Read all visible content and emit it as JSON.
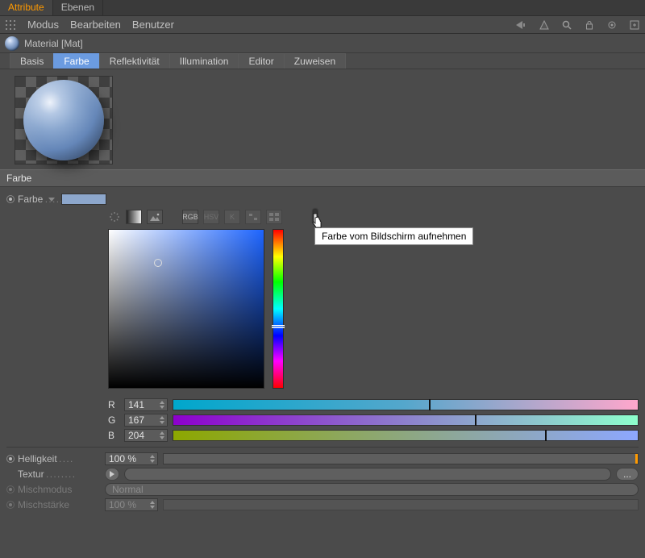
{
  "top_tabs": {
    "attribute": "Attribute",
    "ebenen": "Ebenen"
  },
  "menubar": {
    "modus": "Modus",
    "bearbeiten": "Bearbeiten",
    "benutzer": "Benutzer"
  },
  "material_label": "Material [Mat]",
  "chan": {
    "basis": "Basis",
    "farbe": "Farbe",
    "reflek": "Reflektivität",
    "illum": "Illumination",
    "editor": "Editor",
    "zuweisen": "Zuweisen"
  },
  "section_title": "Farbe",
  "params": {
    "farbe_label": "Farbe",
    "helligkeit_label": "Helligkeit",
    "helligkeit_value": "100 %",
    "textur_label": "Textur",
    "mischmodus_label": "Mischmodus",
    "mischmodus_value": "Normal",
    "mischstaerke_label": "Mischstärke",
    "mischstaerke_value": "100 %"
  },
  "color": {
    "swatch_hex": "#8da7cc",
    "r": "141",
    "g": "167",
    "b": "204",
    "r_label": "R",
    "g_label": "G",
    "b_label": "B",
    "r_pct": 55,
    "g_pct": 65,
    "b_pct": 80
  },
  "icon_labels": {
    "rgb": "RGB",
    "hsv": "HSV"
  },
  "tooltip": "Farbe vom Bildschirm aufnehmen",
  "dots_btn": "..."
}
